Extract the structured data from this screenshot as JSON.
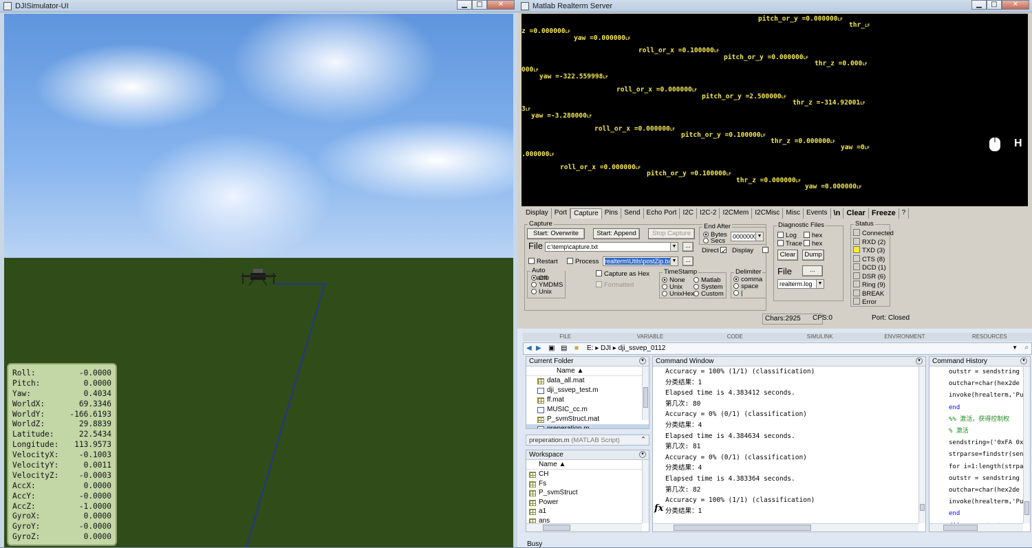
{
  "sim": {
    "title": "DJISimulator-UI",
    "telemetry": [
      {
        "label": "Roll:",
        "value": "-0.0000"
      },
      {
        "label": "Pitch:",
        "value": "0.0000"
      },
      {
        "label": "Yaw:",
        "value": "0.4034"
      },
      {
        "label": "WorldX:",
        "value": "69.3346"
      },
      {
        "label": "WorldY:",
        "value": "-166.6193"
      },
      {
        "label": "WorldZ:",
        "value": "29.8839"
      },
      {
        "label": "Latitude:",
        "value": "22.5434"
      },
      {
        "label": "Longitude:",
        "value": "113.9573"
      },
      {
        "label": "VelocityX:",
        "value": "-0.1003"
      },
      {
        "label": "VelocityY:",
        "value": "0.0011"
      },
      {
        "label": "VelocityZ:",
        "value": "-0.0003"
      },
      {
        "label": "AccX:",
        "value": "0.0000"
      },
      {
        "label": "AccY:",
        "value": "-0.0000"
      },
      {
        "label": "AccZ:",
        "value": "-1.0000"
      },
      {
        "label": "GyroX:",
        "value": "0.0000"
      },
      {
        "label": "GyroY:",
        "value": "-0.0000"
      },
      {
        "label": "GyroZ:",
        "value": "0.0000"
      }
    ]
  },
  "window_buttons": {
    "minimize": "▁",
    "maximize": "□",
    "close": "✕"
  },
  "realterm": {
    "title": "Matlab Realterm Server",
    "terminal_lines": [
      "pitch_or_y =0.000000",
      "thr_",
      "z =0.000000",
      "yaw =0.000000",
      "roll_or_x =0.100000",
      "pitch_or_y =0.000000",
      "thr_z =0.000",
      "000",
      "yaw =-322.559998",
      "roll_or_x =0.000000",
      "pitch_or_y =2.500000",
      "thr_z =-314.92001",
      "3",
      "yaw =-3.280000",
      "roll_or_x =0.000000",
      "pitch_or_y =0.100000",
      "thr_z =0.000000",
      "yaw =0",
      ".000000",
      "roll_or_x =0.000000",
      "pitch_or_y =0.100000",
      "thr_z =0.000000",
      "yaw =0.000000"
    ],
    "lf_mark": "LF",
    "h_label": "H",
    "tabs": [
      "Display",
      "Port",
      "Capture",
      "Pins",
      "Send",
      "Echo Port",
      "I2C",
      "I2C-2",
      "I2CMem",
      "I2CMisc",
      "Misc",
      "Events",
      "\\n",
      "Clear",
      "Freeze",
      "?"
    ],
    "capture": {
      "group": "Capture",
      "start_overwrite": "Start: Overwrite",
      "start_append": "Start: Append",
      "stop_capture": "Stop Capture",
      "file_label": "File",
      "file_path": "c:\\temp\\capture.txt",
      "browse": "...",
      "restart": "Restart",
      "process": "Process",
      "process_path": "realterm\\Utils\\postZip.bat",
      "end_after": "End After",
      "bytes": "Bytes",
      "secs": "Secs",
      "end_value": "0000000",
      "direct": "Direct",
      "display": "Display",
      "auto_name": "Auto Name",
      "auto_opts": [
        "Off",
        "YMDMS",
        "Unix"
      ],
      "capture_hex": "Capture as Hex",
      "formatted": "Formatted",
      "timestamp": "TimeStamp",
      "ts_opts": [
        "None",
        "Unix",
        "UnixHex",
        "Matlab",
        "System",
        "Custom"
      ],
      "delimiter": "Delimiter",
      "delim_opts": [
        "comma",
        "space",
        "|"
      ]
    },
    "diag": {
      "group": "Diagnostic Files",
      "log": "Log",
      "hex1": "hex",
      "trace": "Trace",
      "hex2": "hex",
      "clear": "Clear",
      "dump": "Dump",
      "file": "File",
      "browse": "...",
      "logfile": "realterm.log"
    },
    "status": {
      "group": "Status",
      "items": [
        "Connected",
        "RXD (2)",
        "TXD (3)",
        "CTS (8)",
        "DCD (1)",
        "DSR (6)",
        "Ring (9)",
        "BREAK",
        "Error"
      ]
    },
    "statusbar": {
      "chars": "Chars:2925",
      "cps": "CPS:0",
      "port": "Port: Closed"
    }
  },
  "matlab": {
    "ribbon": [
      "FILE",
      "VARIABLE",
      "CODE",
      "SIMULINK",
      "ENVIRONMENT",
      "RESOURCES"
    ],
    "path": [
      "E:",
      "DJI",
      "dji_ssvep_0112"
    ],
    "current_folder": {
      "title": "Current Folder",
      "col": "Name",
      "files": [
        "data_all.mat",
        "dji_ssvep_test.m",
        "ff.mat",
        "MUSIC_cc.m",
        "P_svmStruct.mat",
        "preperation.m"
      ],
      "details": "preperation.m",
      "details_type": "(MATLAB Script)"
    },
    "workspace": {
      "title": "Workspace",
      "col": "Name",
      "vars": [
        "CH",
        "Fs",
        "P_svmStruct",
        "Power",
        "a1",
        "ans"
      ]
    },
    "command_window": {
      "title": "Command Window",
      "lines": [
        "Accuracy = 100% (1/1) (classification)",
        "分类结果：1",
        "Elapsed time is 4.383412 seconds.",
        "第几次: 80",
        "Accuracy = 0% (0/1) (classification)",
        "分类结果：4",
        "Elapsed time is 4.384634 seconds.",
        "第几次: 81",
        "Accuracy = 0% (0/1) (classification)",
        "分类结果：4",
        "Elapsed time is 4.383364 seconds.",
        "第几次: 82",
        "Accuracy = 100% (1/1) (classification)",
        "分类结果：1"
      ],
      "fx": "fx"
    },
    "command_history": {
      "title": "Command History",
      "lines": [
        {
          "t": "outstr = sendstring",
          "c": ""
        },
        {
          "t": "outchar=char(hex2de",
          "c": ""
        },
        {
          "t": "invoke(hrealterm,'Pu",
          "c": ""
        },
        {
          "t": "end",
          "c": "kw"
        },
        {
          "t": "%% 激活，获得控制权",
          "c": "cm"
        },
        {
          "t": "% 激活",
          "c": "cm"
        },
        {
          "t": "sendstring=('0xFA 0x",
          "c": ""
        },
        {
          "t": "strparse=findstr(sen",
          "c": ""
        },
        {
          "t": "for i=1:length(strpa",
          "c": ""
        },
        {
          "t": "outstr = sendstring",
          "c": ""
        },
        {
          "t": "outchar=char(hex2de",
          "c": ""
        },
        {
          "t": "invoke(hrealterm,'Pu",
          "c": ""
        },
        {
          "t": "end",
          "c": "kw"
        },
        {
          "t": "dji_ssvep_test",
          "c": ""
        }
      ]
    },
    "status": "Busy"
  }
}
